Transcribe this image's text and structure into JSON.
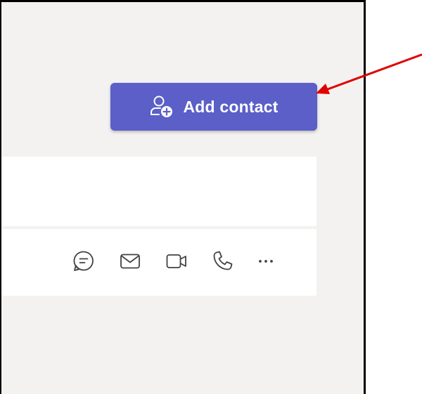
{
  "add_contact": {
    "label": "Add contact",
    "icon": "person-add-icon",
    "color": "#5b5fc7"
  },
  "contact_actions": [
    {
      "name": "chat",
      "icon": "chat-icon"
    },
    {
      "name": "email",
      "icon": "mail-icon"
    },
    {
      "name": "video-call",
      "icon": "video-icon"
    },
    {
      "name": "audio-call",
      "icon": "phone-icon"
    },
    {
      "name": "more-options",
      "icon": "more-icon"
    }
  ],
  "colors": {
    "panel_background": "#f3f2f1",
    "card_background": "#ffffff",
    "icon_color": "#424242",
    "annotation_arrow": "#e00000"
  }
}
